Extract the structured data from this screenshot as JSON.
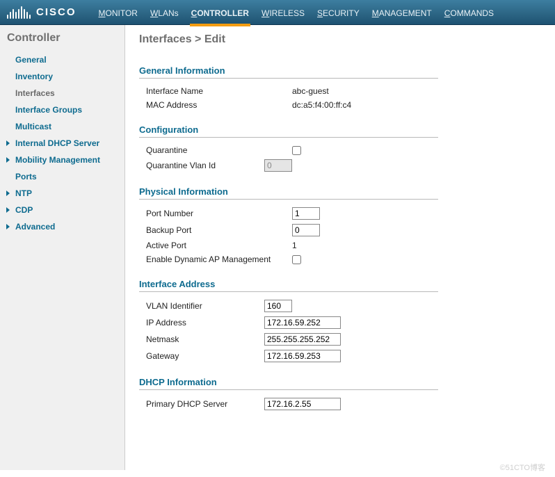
{
  "brand": "cisco",
  "topnav": [
    {
      "label": "MONITOR",
      "underline": "M"
    },
    {
      "label": "WLANs",
      "underline": "W"
    },
    {
      "label": "CONTROLLER",
      "underline": "C",
      "active": true
    },
    {
      "label": "WIRELESS",
      "underline": "W"
    },
    {
      "label": "SECURITY",
      "underline": "S"
    },
    {
      "label": "MANAGEMENT",
      "underline": "M"
    },
    {
      "label": "COMMANDS",
      "underline": "C"
    }
  ],
  "sidebar": {
    "title": "Controller",
    "items": [
      {
        "label": "General"
      },
      {
        "label": "Inventory"
      },
      {
        "label": "Interfaces",
        "active": true
      },
      {
        "label": "Interface Groups"
      },
      {
        "label": "Multicast"
      },
      {
        "label": "Internal DHCP Server",
        "children": true
      },
      {
        "label": "Mobility Management",
        "children": true
      },
      {
        "label": "Ports"
      },
      {
        "label": "NTP",
        "children": true
      },
      {
        "label": "CDP",
        "children": true
      },
      {
        "label": "Advanced",
        "children": true
      }
    ]
  },
  "breadcrumb": "Interfaces > Edit",
  "sections": {
    "general": {
      "title": "General Information",
      "interface_name_label": "Interface Name",
      "interface_name_value": "abc-guest",
      "mac_label": "MAC Address",
      "mac_value": "dc:a5:f4:00:ff:c4"
    },
    "config": {
      "title": "Configuration",
      "quarantine_label": "Quarantine",
      "quarantine_checked": false,
      "qvlan_label": "Quarantine Vlan Id",
      "qvlan_value": "0",
      "qvlan_disabled": true
    },
    "physical": {
      "title": "Physical Information",
      "port_label": "Port Number",
      "port_value": "1",
      "backup_label": "Backup Port",
      "backup_value": "0",
      "active_label": "Active Port",
      "active_value": "1",
      "dynap_label": "Enable Dynamic AP Management",
      "dynap_checked": false
    },
    "address": {
      "title": "Interface Address",
      "vlan_label": "VLAN Identifier",
      "vlan_value": "160",
      "ip_label": "IP Address",
      "ip_value": "172.16.59.252",
      "mask_label": "Netmask",
      "mask_value": "255.255.255.252",
      "gw_label": "Gateway",
      "gw_value": "172.16.59.253"
    },
    "dhcp": {
      "title": "DHCP Information",
      "primary_label": "Primary DHCP Server",
      "primary_value": "172.16.2.55"
    }
  },
  "watermark": "©51CTO博客"
}
